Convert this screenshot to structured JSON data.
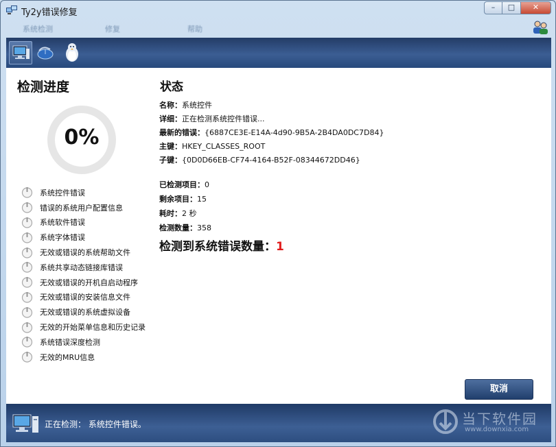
{
  "window": {
    "title": "Ty2y错误修复"
  },
  "menu": {
    "items": [
      "系统检测",
      "修复",
      "帮助"
    ]
  },
  "toolbar": {
    "icons": [
      "computer-icon",
      "mouse-icon",
      "penguin-icon"
    ]
  },
  "progress": {
    "title": "检测进度",
    "percent_text": "0%",
    "percent": 0,
    "items": [
      "系统控件错误",
      "错误的系统用户配置信息",
      "系统软件错误",
      "系统字体错误",
      "无效或错误的系统帮助文件",
      "系统共享动态链接库错误",
      "无效或错误的开机自启动程序",
      "无效或错误的安装信息文件",
      "无效或错误的系统虚拟设备",
      "无效的开始菜单信息和历史记录",
      "系统错误深度检测",
      "无效的MRU信息"
    ]
  },
  "status": {
    "title": "状态",
    "name_label": "名称：",
    "name_value": "系统控件",
    "detail_label": "详细：",
    "detail_value": "正在检测系统控件错误...",
    "latest_error_label": "最新的错误：",
    "latest_error_value": "{6887CE3E-E14A-4d90-9B5A-2B4DA0DC7D84}",
    "main_key_label": "主键：",
    "main_key_value": "HKEY_CLASSES_ROOT",
    "sub_key_label": "子键：",
    "sub_key_value": "{0D0D66EB-CF74-4164-B52F-08344672DD46}",
    "checked_label": "已检测项目：",
    "checked_value": "0",
    "remaining_label": "剩余项目：",
    "remaining_value": "15",
    "elapsed_label": "耗时：",
    "elapsed_value": "2 秒",
    "count_label": "检测数量：",
    "count_value": "358",
    "summary_label": "检测到系统错误数量：",
    "summary_value": "1"
  },
  "buttons": {
    "cancel": "取消"
  },
  "statusbar": {
    "text": "正在检测：  系统控件错误。"
  },
  "watermark": {
    "main": "当下软件园",
    "sub": "www.downxia.com"
  },
  "colors": {
    "accent_red": "#e11b1b",
    "toolbar_blue": "#2d4e80"
  }
}
